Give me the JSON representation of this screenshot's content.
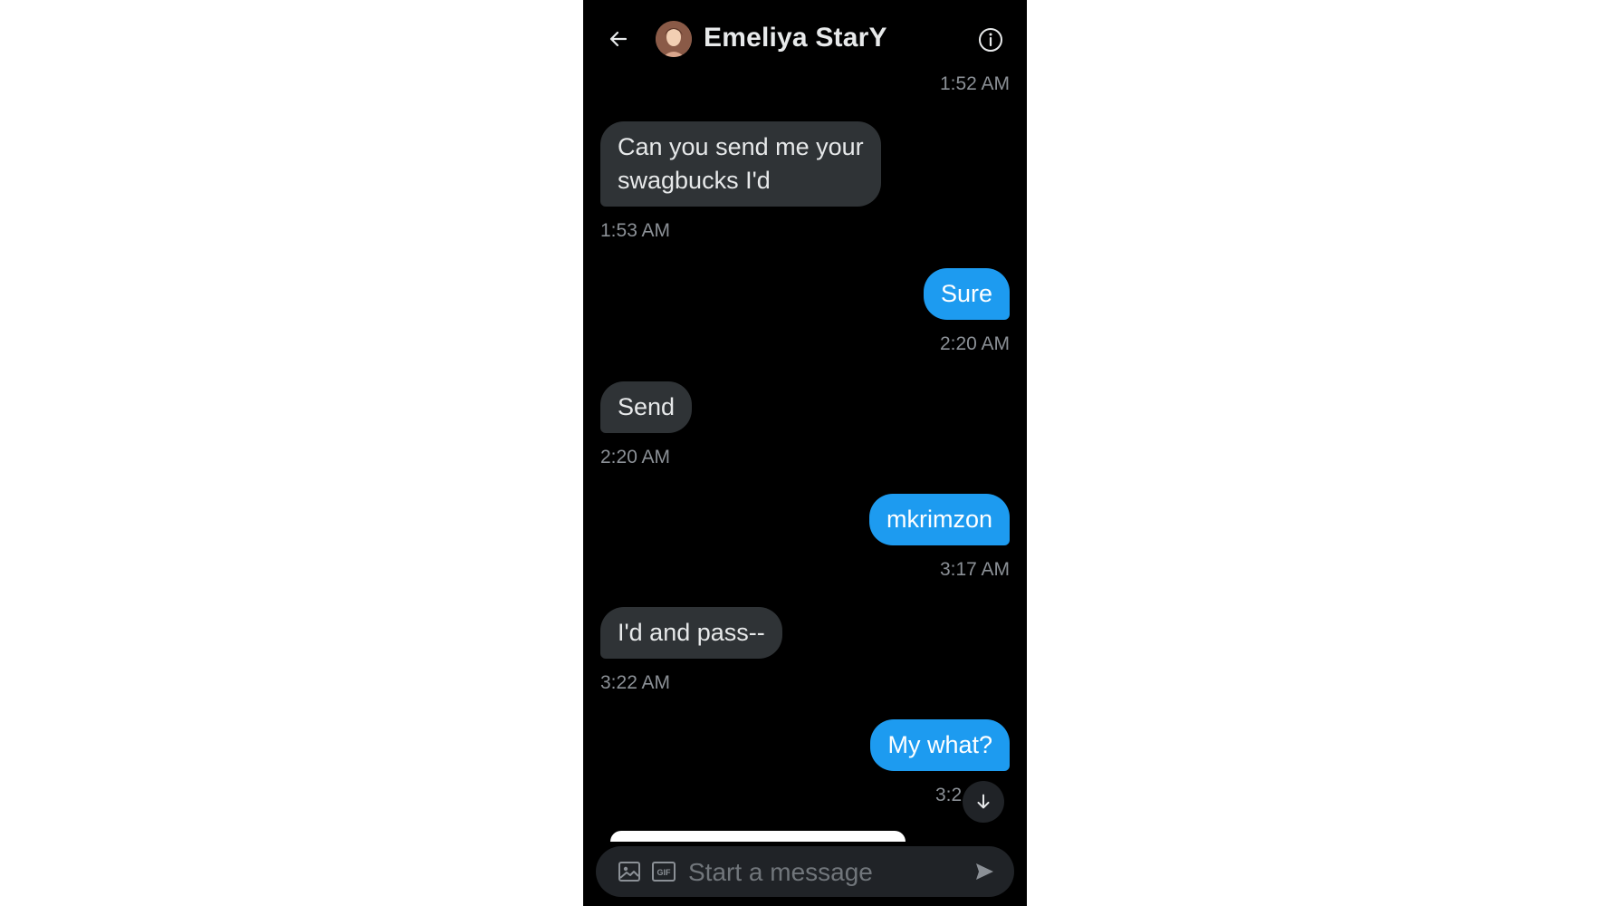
{
  "header": {
    "contact_name": "Emeliya StarY",
    "back_icon": "arrow-left-icon",
    "info_icon": "info-circle-icon"
  },
  "messages": [
    {
      "direction": "out",
      "text": "",
      "time": "1:52 AM"
    },
    {
      "direction": "in",
      "lines": [
        "Can you send me your",
        "swagbucks I'd"
      ],
      "time": "1:53 AM"
    },
    {
      "direction": "out",
      "text": "Sure",
      "time": "2:20 AM"
    },
    {
      "direction": "in",
      "text": "Send",
      "time": "2:20 AM"
    },
    {
      "direction": "out",
      "text": "mkrimzon",
      "time": "3:17 AM"
    },
    {
      "direction": "in",
      "text": "I'd and pass--",
      "time": "3:22 AM"
    },
    {
      "direction": "out",
      "text": "My what?",
      "time": "3:2"
    }
  ],
  "scroll_down_icon": "arrow-down-icon",
  "composer": {
    "placeholder": "Start a message",
    "value": "",
    "image_icon": "image-icon",
    "gif_icon": "gif-icon",
    "gif_label": "GIF",
    "send_icon": "send-icon"
  },
  "colors": {
    "background": "#000000",
    "incoming_bubble": "#2f3336",
    "outgoing_bubble": "#1d9bf0",
    "timestamp": "#8b9096"
  }
}
